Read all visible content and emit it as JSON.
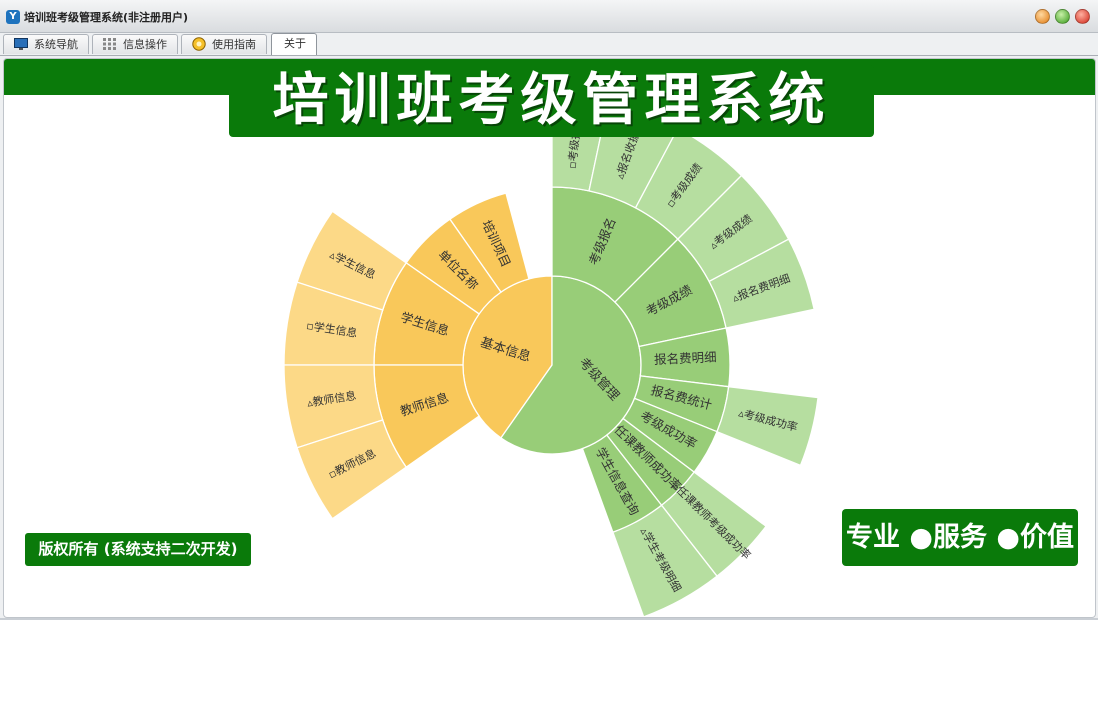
{
  "window": {
    "title": "培训班考级管理系统(非注册用户)"
  },
  "tabs": [
    {
      "label": "系统导航"
    },
    {
      "label": "信息操作"
    },
    {
      "label": "使用指南"
    },
    {
      "label": "关于"
    }
  ],
  "header": {
    "title": "培训班考级管理系统"
  },
  "footer": {
    "copyright": "版权所有 (系统支持二次开发)",
    "slogan": "专业 ●服务 ●价值"
  },
  "sunburst": {
    "colors": {
      "basic": "#f9c85a",
      "basic_outer": "#fcd987",
      "exam": "#98cd78",
      "exam_outer": "#b6dea0"
    },
    "root": [
      {
        "label": "基本信息",
        "group": "basic"
      },
      {
        "label": "考级管理",
        "group": "exam"
      }
    ],
    "level1": [
      {
        "label": "培训项目",
        "group": "basic"
      },
      {
        "label": "单位名称",
        "group": "basic"
      },
      {
        "label": "学生信息",
        "group": "basic"
      },
      {
        "label": "教师信息",
        "group": "basic"
      },
      {
        "label": "考级报名",
        "group": "exam"
      },
      {
        "label": "考级成绩",
        "group": "exam"
      },
      {
        "label": "报名费明细",
        "group": "exam"
      },
      {
        "label": "报名费统计",
        "group": "exam"
      },
      {
        "label": "考级成功率",
        "group": "exam"
      },
      {
        "label": "任课教师成功率",
        "group": "exam"
      },
      {
        "label": "学生信息查询",
        "group": "exam"
      }
    ],
    "level2": [
      {
        "label": "▵学生信息",
        "group": "basic"
      },
      {
        "label": "▫学生信息",
        "group": "basic"
      },
      {
        "label": "▵教师信息",
        "group": "basic"
      },
      {
        "label": "▫教师信息",
        "group": "basic"
      },
      {
        "label": "▫考级报名",
        "group": "exam"
      },
      {
        "label": "▵报名收据",
        "group": "exam"
      },
      {
        "label": "▫考级成绩",
        "group": "exam"
      },
      {
        "label": "▵考级成绩",
        "group": "exam"
      },
      {
        "label": "▵报名费明细",
        "group": "exam"
      },
      {
        "label": "▵考级成功率",
        "group": "exam"
      },
      {
        "label": "▵任课教师考级成功率",
        "group": "exam"
      },
      {
        "label": "▵学生考级明细",
        "group": "exam"
      }
    ]
  }
}
